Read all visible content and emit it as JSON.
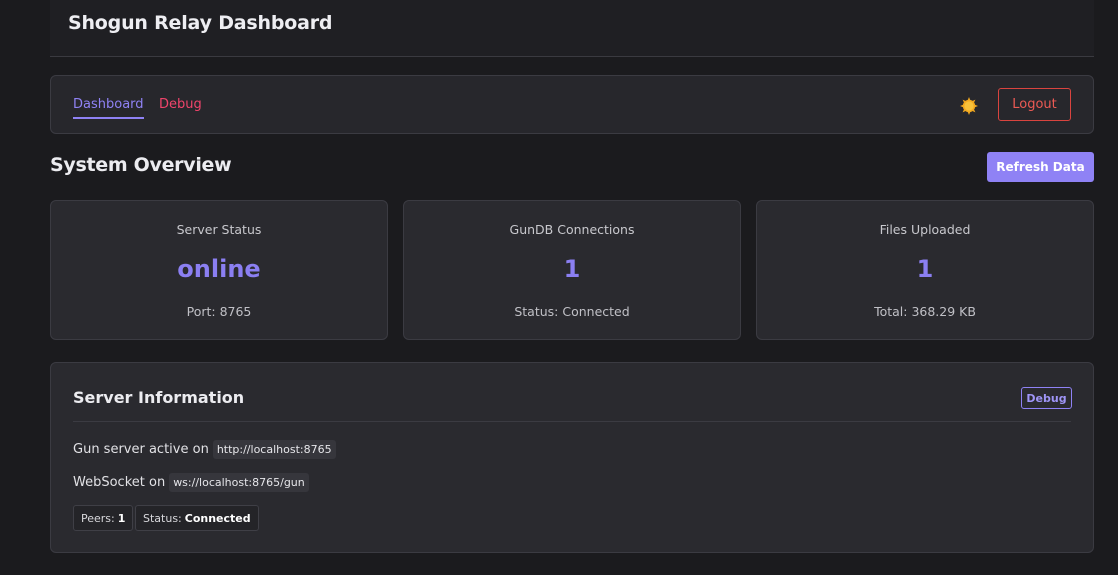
{
  "header": {
    "title": "Shogun Relay Dashboard"
  },
  "nav": {
    "tabs": [
      {
        "label": "Dashboard",
        "active": true
      },
      {
        "label": "Debug",
        "active": false
      }
    ],
    "theme_icon": "sun-icon",
    "logout_label": "Logout"
  },
  "overview": {
    "title": "System Overview",
    "refresh_label": "Refresh Data",
    "cards": [
      {
        "label": "Server Status",
        "value": "online",
        "sub": "Port: 8765"
      },
      {
        "label": "GunDB Connections",
        "value": "1",
        "sub": "Status: Connected"
      },
      {
        "label": "Files Uploaded",
        "value": "1",
        "sub": "Total: 368.29 KB"
      }
    ]
  },
  "server_info": {
    "title": "Server Information",
    "debug_badge": "Debug",
    "gun_prefix": "Gun server active on",
    "gun_url": "http://localhost:8765",
    "ws_prefix": "WebSocket on",
    "ws_url": "ws://localhost:8765/gun",
    "peers_label": "Peers:",
    "peers_value": "1",
    "status_label": "Status:",
    "status_value": "Connected"
  },
  "colors": {
    "accent": "#8f82f5",
    "danger": "#ec5a54",
    "debug_tab": "#f0446b",
    "background": "#1b1b1e",
    "card": "#2a2a2f"
  }
}
